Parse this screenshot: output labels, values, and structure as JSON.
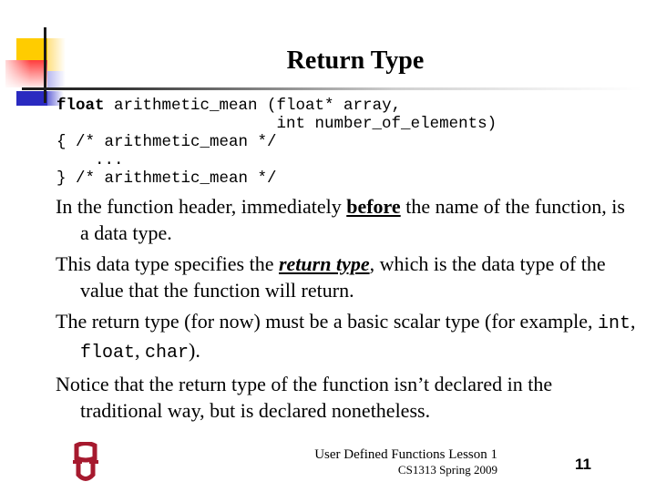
{
  "slide": {
    "title": "Return Type",
    "code": {
      "line1_keyword": "float",
      "line1_rest": " arithmetic_mean (float* array,",
      "line2": "                       int number_of_elements)",
      "line3": "{ /* arithmetic_mean */",
      "line4": "    ...",
      "line5": "} /* arithmetic_mean */"
    },
    "bullets": [
      {
        "pre": "In the function header, immediately ",
        "emph": "before",
        "post": " the name of the function, is a data type."
      },
      {
        "pre": "This data type specifies the ",
        "emph": "return type",
        "post": ", which is the data type of the value that the function will return."
      },
      {
        "pre": "The return type (for now) must be a basic scalar type (for example, ",
        "code1": "int",
        "sep1": ", ",
        "code2": "float",
        "sep2": ", ",
        "code3": "char",
        "post": ")."
      },
      {
        "text": "Notice that the return type of the function isn’t declared in the traditional way, but is declared nonetheless."
      }
    ]
  },
  "footer": {
    "title": "User Defined Functions Lesson 1",
    "subtitle": "CS1313 Spring 2009",
    "page_number": "11",
    "logo": "ou-logo-icon"
  },
  "colors": {
    "logo_red": "#a6192e",
    "deco_yellow": "#ffcc00",
    "deco_red": "#ff3030",
    "deco_blue": "#2a2ac0"
  }
}
